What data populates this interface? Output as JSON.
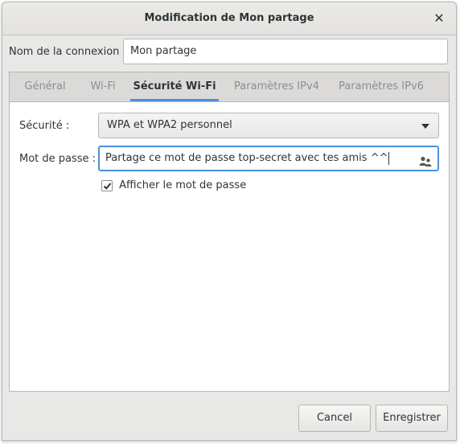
{
  "window": {
    "title": "Modification de Mon partage",
    "close_glyph": "✕"
  },
  "connection": {
    "label": "Nom de la connexion :",
    "value": "Mon partage"
  },
  "tabs": [
    {
      "label": "Général",
      "active": false
    },
    {
      "label": "Wi-Fi",
      "active": false
    },
    {
      "label": "Sécurité Wi-Fi",
      "active": true
    },
    {
      "label": "Paramètres IPv4",
      "active": false
    },
    {
      "label": "Paramètres IPv6",
      "active": false
    }
  ],
  "security": {
    "label": "Sécurité :",
    "selected": "WPA et WPA2 personnel"
  },
  "password": {
    "label": "Mot de passe :",
    "value": "Partage ce mot de passe top-secret avec tes amis ^^",
    "icon": "people-icon"
  },
  "show_password": {
    "label": "Afficher le mot de passe",
    "checked": true
  },
  "buttons": {
    "cancel": "Cancel",
    "save": "Enregistrer"
  },
  "colors": {
    "accent": "#4a90d9",
    "text": "#2e3436",
    "inactive_tab": "#8b8e8f"
  }
}
